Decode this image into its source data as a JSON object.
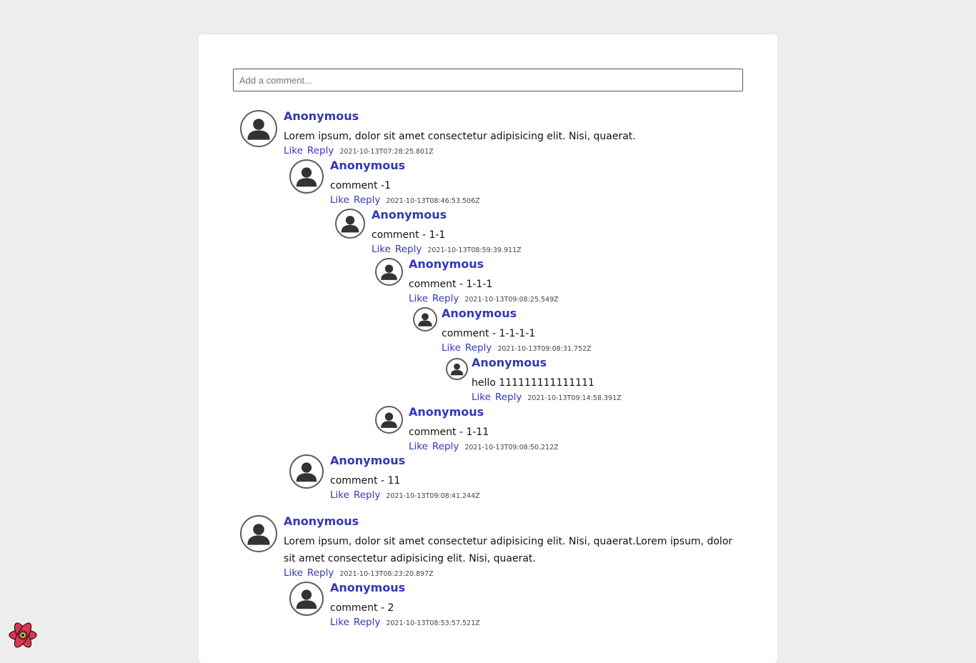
{
  "input": {
    "placeholder": "Add a comment..."
  },
  "labels": {
    "like": "Like",
    "reply": "Reply"
  },
  "comments": [
    {
      "author": "Anonymous",
      "text": "Lorem ipsum, dolor sit amet consectetur adipisicing elit. Nisi, quaerat.",
      "timestamp": "2021-10-13T07:28:25.801Z"
    },
    {
      "author": "Anonymous",
      "text": "comment -1",
      "timestamp": "2021-10-13T08:46:53.506Z"
    },
    {
      "author": "Anonymous",
      "text": "comment - 1-1",
      "timestamp": "2021-10-13T08:59:39.911Z"
    },
    {
      "author": "Anonymous",
      "text": "comment - 1-1-1",
      "timestamp": "2021-10-13T09:08:25.549Z"
    },
    {
      "author": "Anonymous",
      "text": "comment - 1-1-1-1",
      "timestamp": "2021-10-13T09:08:31.752Z"
    },
    {
      "author": "Anonymous",
      "text": "hello 111111111111111",
      "timestamp": "2021-10-13T09:14:58.391Z"
    },
    {
      "author": "Anonymous",
      "text": "comment - 1-11",
      "timestamp": "2021-10-13T09:08:50.212Z"
    },
    {
      "author": "Anonymous",
      "text": "comment - 11",
      "timestamp": "2021-10-13T09:08:41.244Z"
    },
    {
      "author": "Anonymous",
      "text": "Lorem ipsum, dolor sit amet consectetur adipisicing elit. Nisi, quaerat.Lorem ipsum, dolor sit amet consectetur adipisicing elit. Nisi, quaerat.",
      "timestamp": "2021-10-13T08:23:20.897Z"
    },
    {
      "author": "Anonymous",
      "text": "comment - 2",
      "timestamp": "2021-10-13T08:53:57.521Z"
    }
  ],
  "colors": {
    "accent": "#3337b8",
    "background": "#eeedee",
    "card": "#ffffff",
    "logo": "#e0344e"
  }
}
